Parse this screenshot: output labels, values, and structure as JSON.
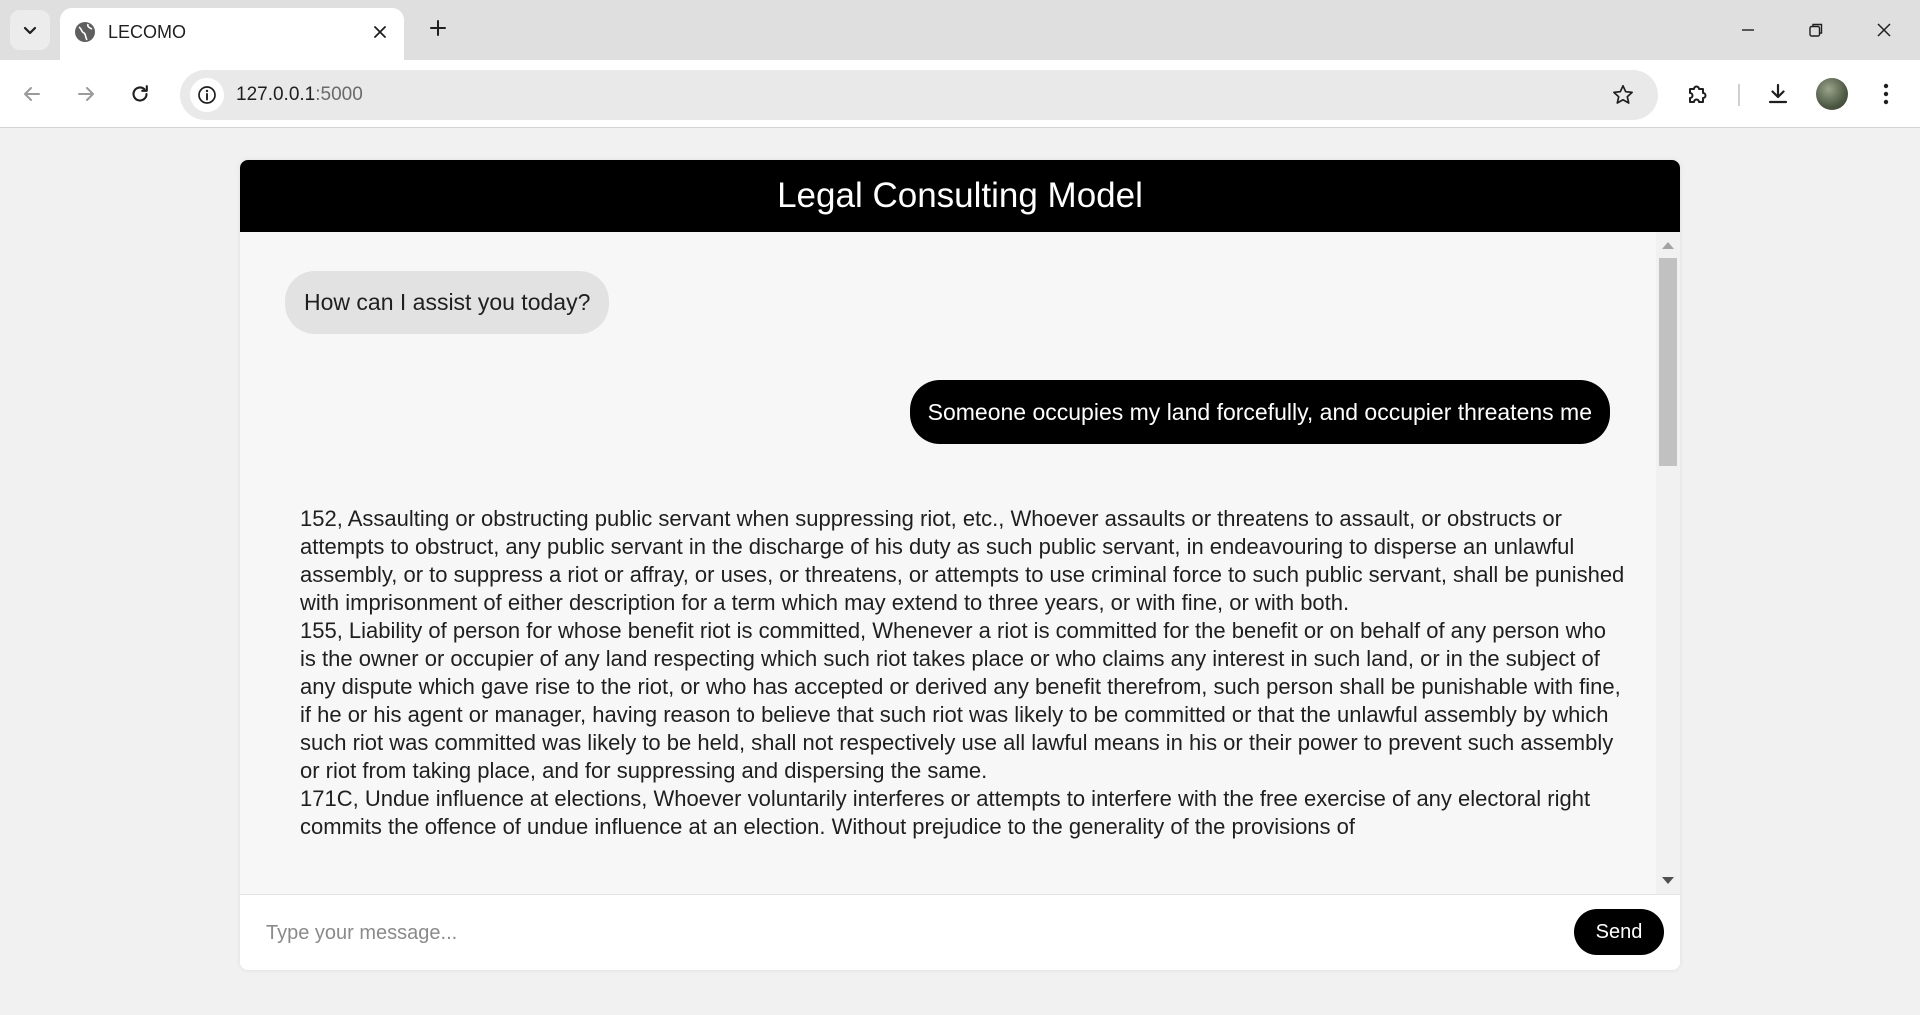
{
  "browser": {
    "tab_title": "LECOMO",
    "url_host": "127.0.0.1",
    "url_port": ":5000",
    "icons": {
      "tab_list": "chevron-down-icon",
      "favicon": "globe-icon",
      "tab_close": "close-icon",
      "new_tab": "plus-icon",
      "minimize": "minimize-icon",
      "restore": "restore-icon",
      "close_window": "close-icon",
      "back": "back-arrow-icon",
      "forward": "forward-arrow-icon",
      "reload": "reload-icon",
      "site_info": "info-icon",
      "bookmark": "star-icon",
      "extensions": "puzzle-icon",
      "downloads": "download-icon",
      "profile": "avatar",
      "menu": "kebab-menu-icon"
    }
  },
  "app": {
    "title": "Legal Consulting Model",
    "messages": {
      "bot_greeting": "How can I assist you today?",
      "user_query": "Someone occupies my land forcefully, and occupier threatens me",
      "answer_sections": [
        "152, Assaulting or obstructing public servant when suppressing riot, etc., Whoever assaults or threatens to assault, or obstructs or attempts to obstruct, any public servant in the discharge of his duty as such public servant, in endeavouring to disperse an unlawful assembly, or to suppress a riot or affray, or uses, or threatens, or attempts to use criminal force to such public servant, shall be punished with imprisonment of either description for a term which may extend to three years, or with fine, or with both.",
        "155, Liability of person for whose benefit riot is committed, Whenever a riot is committed for the benefit or on behalf of any person who is the owner or occupier of any land respecting which such riot takes place or who claims any interest in such land, or in the subject of any dispute which gave rise to the riot, or who has accepted or derived any benefit therefrom, such person shall be punishable with fine, if he or his agent or manager, having reason to believe that such riot was likely to be committed or that the unlawful assembly by which such riot was committed was likely to be held, shall not respectively use all lawful means in his or their power to prevent such assembly or riot from taking place, and for suppressing and dispersing the same.",
        "171C, Undue influence at elections, Whoever voluntarily interferes or attempts to interfere with the free exercise of any electoral right commits the offence of undue influence at an election. Without prejudice to the generality of the provisions of"
      ]
    },
    "composer": {
      "placeholder": "Type your message...",
      "value": "",
      "send_label": "Send"
    }
  },
  "colors": {
    "header_bg": "#000000",
    "user_bubble": "#000000",
    "bot_bubble": "#e2e2e2",
    "chat_bg": "#f7f7f7",
    "page_bg": "#f1f1f1"
  }
}
